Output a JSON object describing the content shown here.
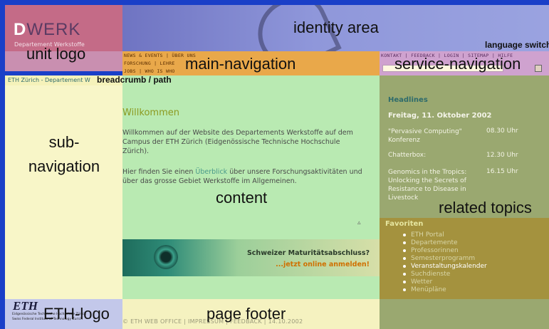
{
  "header": {
    "logo_letter": "D",
    "logo_rest": "WERK",
    "logo_subtitle": "Departement Werkstoffe",
    "language_switch": "language switch"
  },
  "labels": {
    "unit_logo": "unit logo",
    "identity_area": "identity area",
    "main_navigation": "main-navigation",
    "service_navigation": "service-navigation",
    "breadcrumb": "breadcrumb / path",
    "sub_navigation": "sub-\nnavigation",
    "content": "content",
    "related_topics": "related topics",
    "eth_logo": "ETH-logo",
    "page_footer": "page footer"
  },
  "main_nav": {
    "line1": "NEWS & EVENTS | ÜBER UNS",
    "line2": "FORSCHUNG | LEHRE",
    "line3": "JOBS | WHO IS WHO"
  },
  "service_nav": {
    "links": "KONTAKT | FEEDBACK | LOGIN | SITEMAP | HILFE"
  },
  "breadcrumb_text": "ETH Zürich - Departement W",
  "content": {
    "heading": "Willkommen",
    "para1": "Willkommen auf der Website des Departements Werkstoffe auf dem Campus der ETH Zürich (Eidgenössische Technische Hochschule Zürich).",
    "para2_pre": "Hier finden Sie einen ",
    "para2_link": "Überblick",
    "para2_post": " über unsere Forschungsaktivitäten und über das grosse Gebiet Werkstoffe im Allgemeinen.",
    "up_arrow": "▵",
    "banner_title": "Schweizer Maturitätsabschluss?",
    "banner_cta": "...jetzt online anmelden!"
  },
  "related": {
    "headlines_title": "Headlines",
    "date": "Freitag, 11. Oktober 2002",
    "events": [
      {
        "title": "\"Pervasive Computing\" Konferenz",
        "time": "08.30 Uhr"
      },
      {
        "title": "Chatterbox:",
        "time": "12.30 Uhr"
      },
      {
        "title": "Genomics in the Tropics: Unlocking the Secrets of Resistance to Disease in Livestock",
        "time": "16.15 Uhr"
      }
    ]
  },
  "favoriten": {
    "title": "Favoriten",
    "items": [
      "ETH Portal",
      "Departemente",
      "Professorinnen",
      "Semesterprogramm",
      "Veranstaltungskalender",
      "Suchdienste",
      "Wetter",
      "Menüpläne"
    ]
  },
  "eth": {
    "logo": "ETH",
    "line1": "Eidgenössische Technische Hochschule Zürich",
    "line2": "Swiss Federal Institute of Technology Zurich"
  },
  "footer": {
    "text": "© ETH WEB OFFICE | IMPRESSUM | FEEDBACK | 14.10.2002"
  },
  "colors": {
    "frame": "#1a3fc8",
    "content_bg": "#b9eab2",
    "subnav_bg": "#f8f6c8",
    "mainnav_bg": "#e9a84a"
  }
}
